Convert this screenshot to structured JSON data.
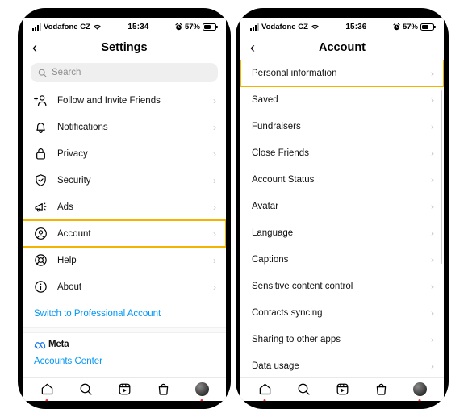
{
  "left_phone": {
    "status_bar": {
      "carrier": "Vodafone CZ",
      "time": "15:34",
      "battery_percent": "57%",
      "wifi_icon": "wifi-icon",
      "alarm_icon": "alarm-icon",
      "signal_icon": "signal-bars-icon",
      "battery_icon": "battery-icon"
    },
    "nav": {
      "back_icon": "chevron-left-icon",
      "title": "Settings"
    },
    "search": {
      "placeholder": "Search",
      "icon": "search-icon"
    },
    "menu_items": [
      {
        "label": "Follow and Invite Friends",
        "icon": "add-person-icon",
        "chevron": "›",
        "highlighted": false
      },
      {
        "label": "Notifications",
        "icon": "bell-icon",
        "chevron": "›",
        "highlighted": false
      },
      {
        "label": "Privacy",
        "icon": "lock-icon",
        "chevron": "›",
        "highlighted": false
      },
      {
        "label": "Security",
        "icon": "shield-check-icon",
        "chevron": "›",
        "highlighted": false
      },
      {
        "label": "Ads",
        "icon": "megaphone-icon",
        "chevron": "›",
        "highlighted": false
      },
      {
        "label": "Account",
        "icon": "account-circle-icon",
        "chevron": "›",
        "highlighted": true
      },
      {
        "label": "Help",
        "icon": "lifebuoy-icon",
        "chevron": "›",
        "highlighted": false
      },
      {
        "label": "About",
        "icon": "info-circle-icon",
        "chevron": "›",
        "highlighted": false
      }
    ],
    "professional_link": "Switch to Professional Account",
    "meta_brand": "Meta",
    "accounts_center_link": "Accounts Center",
    "tabs": [
      {
        "name": "home-tab",
        "icon": "home-icon",
        "has_dot": true
      },
      {
        "name": "search-tab",
        "icon": "search-icon",
        "has_dot": false
      },
      {
        "name": "reels-tab",
        "icon": "reels-icon",
        "has_dot": false
      },
      {
        "name": "shop-tab",
        "icon": "shopping-bag-icon",
        "has_dot": false
      },
      {
        "name": "profile-tab",
        "icon": "profile-avatar-icon",
        "has_dot": true
      }
    ]
  },
  "right_phone": {
    "status_bar": {
      "carrier": "Vodafone CZ",
      "time": "15:36",
      "battery_percent": "57%",
      "wifi_icon": "wifi-icon",
      "alarm_icon": "alarm-icon",
      "signal_icon": "signal-bars-icon",
      "battery_icon": "battery-icon"
    },
    "nav": {
      "back_icon": "chevron-left-icon",
      "title": "Account"
    },
    "menu_items": [
      {
        "label": "Personal information",
        "chevron": "›",
        "highlighted": true
      },
      {
        "label": "Saved",
        "chevron": "›",
        "highlighted": false
      },
      {
        "label": "Fundraisers",
        "chevron": "›",
        "highlighted": false
      },
      {
        "label": "Close Friends",
        "chevron": "›",
        "highlighted": false
      },
      {
        "label": "Account Status",
        "chevron": "›",
        "highlighted": false
      },
      {
        "label": "Avatar",
        "chevron": "›",
        "highlighted": false
      },
      {
        "label": "Language",
        "chevron": "›",
        "highlighted": false
      },
      {
        "label": "Captions",
        "chevron": "›",
        "highlighted": false
      },
      {
        "label": "Sensitive content control",
        "chevron": "›",
        "highlighted": false
      },
      {
        "label": "Contacts syncing",
        "chevron": "›",
        "highlighted": false
      },
      {
        "label": "Sharing to other apps",
        "chevron": "›",
        "highlighted": false
      },
      {
        "label": "Data usage",
        "chevron": "›",
        "highlighted": false
      }
    ],
    "tabs": [
      {
        "name": "home-tab",
        "icon": "home-icon",
        "has_dot": true
      },
      {
        "name": "search-tab",
        "icon": "search-icon",
        "has_dot": false
      },
      {
        "name": "reels-tab",
        "icon": "reels-icon",
        "has_dot": false
      },
      {
        "name": "shop-tab",
        "icon": "shopping-bag-icon",
        "has_dot": false
      },
      {
        "name": "profile-tab",
        "icon": "profile-avatar-icon",
        "has_dot": true
      }
    ]
  },
  "colors": {
    "highlight": "#f5b301",
    "link_blue": "#0095f6",
    "meta_blue": "#1877f2",
    "dot_red": "#ff2d2d",
    "chevron_grey": "#c7c7cc"
  }
}
